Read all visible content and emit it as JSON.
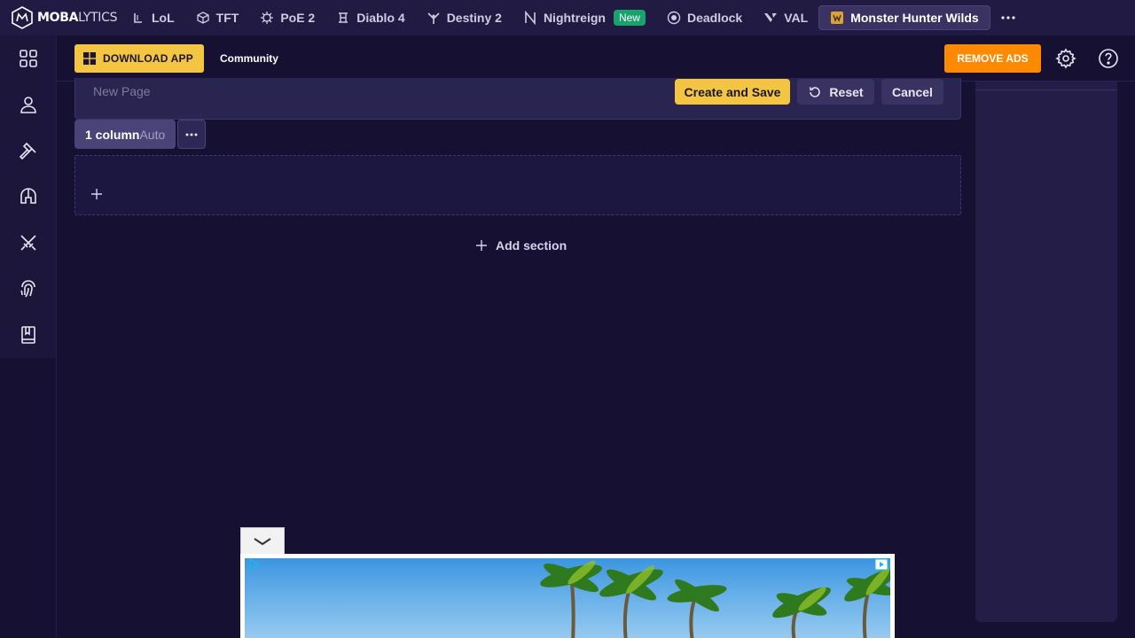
{
  "brand": {
    "name_bold": "MOBA",
    "name_light": "LYTICS"
  },
  "top_nav": {
    "games": [
      {
        "label": "LoL",
        "icon": "lol-icon"
      },
      {
        "label": "TFT",
        "icon": "tft-icon"
      },
      {
        "label": "PoE 2",
        "icon": "poe2-icon"
      },
      {
        "label": "Diablo 4",
        "icon": "diablo4-icon"
      },
      {
        "label": "Destiny 2",
        "icon": "destiny2-icon"
      },
      {
        "label": "Nightreign",
        "icon": "nightreign-icon",
        "badge": "New"
      },
      {
        "label": "Deadlock",
        "icon": "deadlock-icon"
      },
      {
        "label": "VAL",
        "icon": "valorant-icon"
      },
      {
        "label": "Monster Hunter Wilds",
        "icon": "monster-hunter-icon",
        "active": true
      }
    ]
  },
  "sidebar": {
    "items": [
      {
        "icon": "grid-icon"
      },
      {
        "icon": "profile-icon"
      },
      {
        "icon": "hammer-icon"
      },
      {
        "icon": "helmet-icon"
      },
      {
        "icon": "crossed-swords-icon"
      },
      {
        "icon": "fingerprint-icon"
      },
      {
        "icon": "book-icon"
      }
    ]
  },
  "subheader": {
    "download_label": "DOWNLOAD APP",
    "community_label": "Community",
    "remove_ads_label": "REMOVE ADS"
  },
  "editor": {
    "page_name_placeholder": "New Page",
    "create_label": "Create and Save",
    "reset_label": "Reset",
    "cancel_label": "Cancel",
    "columns_label": "1 column",
    "columns_mode": "Auto",
    "add_section_label": "Add section"
  },
  "colors": {
    "accent_yellow": "#f4c542",
    "remove_ads_orange": "#ff8a00",
    "new_badge_green": "#17a36b",
    "background": "#161132"
  }
}
